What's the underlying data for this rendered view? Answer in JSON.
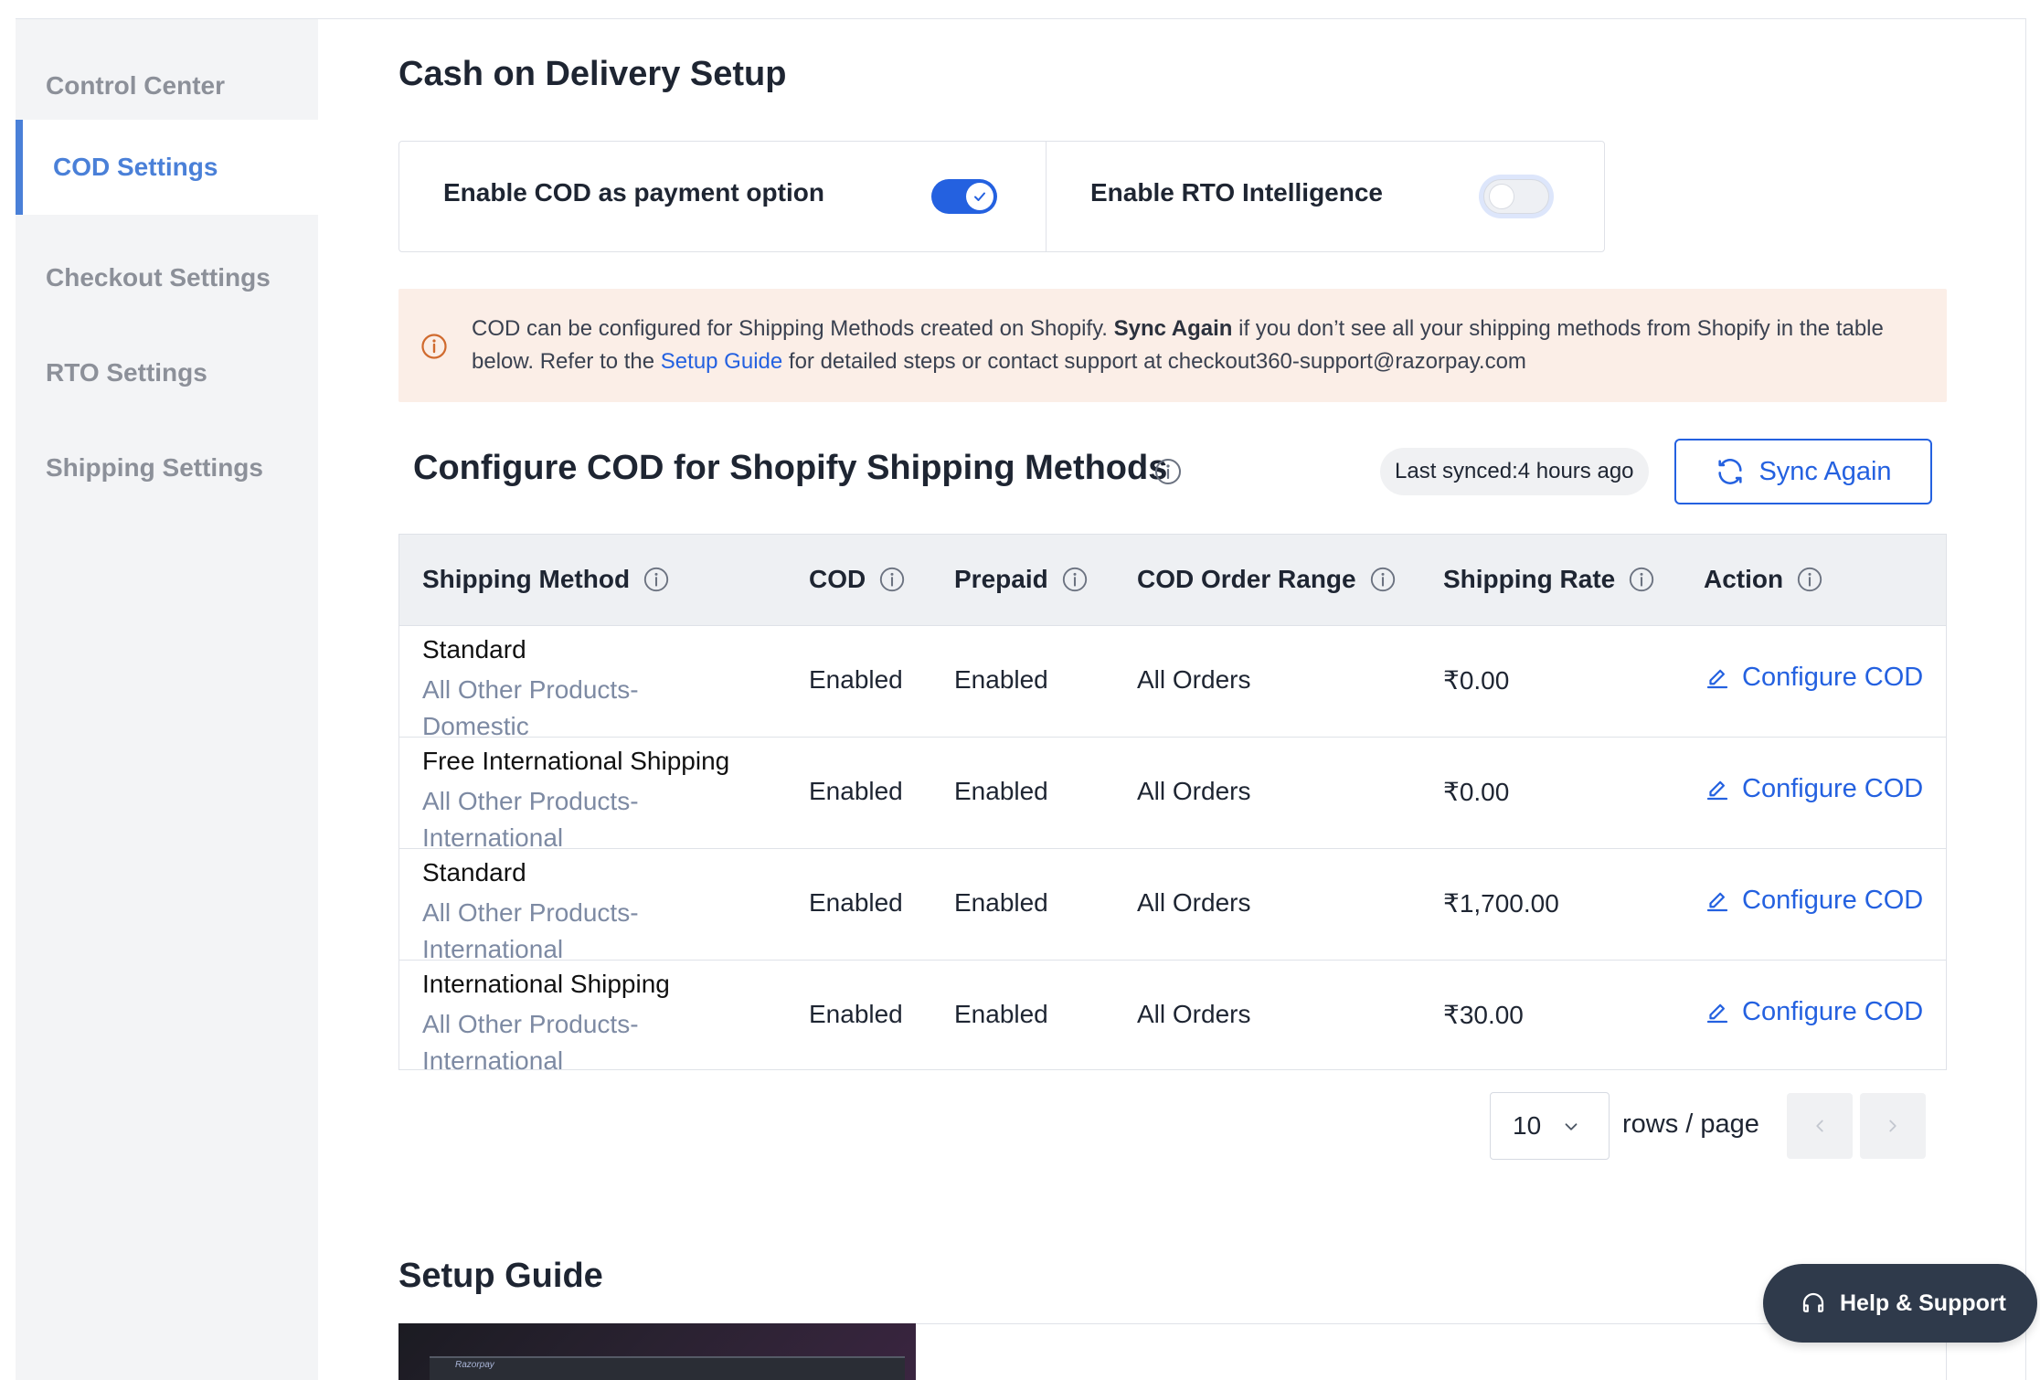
{
  "sidebar": {
    "items": [
      {
        "label": "Control Center"
      },
      {
        "label": "COD Settings"
      },
      {
        "label": "Checkout Settings"
      },
      {
        "label": "RTO Settings"
      },
      {
        "label": "Shipping Settings"
      }
    ],
    "active_index": 1
  },
  "page": {
    "title": "Cash on Delivery Setup"
  },
  "toggles": {
    "cod": {
      "label": "Enable COD as payment option",
      "state": "on"
    },
    "rto": {
      "label": "Enable RTO Intelligence",
      "state": "off"
    }
  },
  "banner": {
    "text_1": "COD can be configured for Shipping Methods created on Shopify. ",
    "bold": "Sync Again",
    "text_2": " if you don’t see all your shipping methods from Shopify in the table below. Refer to the ",
    "link": "Setup Guide",
    "text_3": " for detailed steps or contact support at checkout360-support@razorpay.com"
  },
  "section": {
    "title": "Configure COD for Shopify Shipping Methods",
    "last_synced_label": "Last synced:",
    "last_synced_value": "4 hours ago",
    "sync_button": "Sync Again"
  },
  "table": {
    "headers": [
      "Shipping Method",
      "COD",
      "Prepaid",
      "COD Order Range",
      "Shipping Rate",
      "Action"
    ],
    "rows": [
      {
        "name": "Standard",
        "sub_1": "All Other Products-",
        "sub_2": "Domestic",
        "cod": "Enabled",
        "prepaid": "Enabled",
        "range": "All Orders",
        "rate": "₹0.00",
        "action": "Configure COD"
      },
      {
        "name": "Free International Shipping",
        "sub_1": "All Other Products-",
        "sub_2": "International",
        "cod": "Enabled",
        "prepaid": "Enabled",
        "range": "All Orders",
        "rate": "₹0.00",
        "action": "Configure COD"
      },
      {
        "name": "Standard",
        "sub_1": "All Other Products-",
        "sub_2": "International",
        "cod": "Enabled",
        "prepaid": "Enabled",
        "range": "All Orders",
        "rate": "₹1,700.00",
        "action": "Configure COD"
      },
      {
        "name": "International Shipping",
        "sub_1": "All Other Products-",
        "sub_2": "International",
        "cod": "Enabled",
        "prepaid": "Enabled",
        "range": "All Orders",
        "rate": "₹30.00",
        "action": "Configure COD"
      }
    ]
  },
  "pagination": {
    "rows_per_page": "10",
    "label": "rows / page"
  },
  "guide": {
    "title": "Setup Guide"
  },
  "help": {
    "label": "Help & Support"
  },
  "colors": {
    "accent": "#2461e0",
    "sidebar_active": "#4a80d8",
    "banner_bg": "#fbeee7",
    "warning_icon": "#d06a2e"
  }
}
